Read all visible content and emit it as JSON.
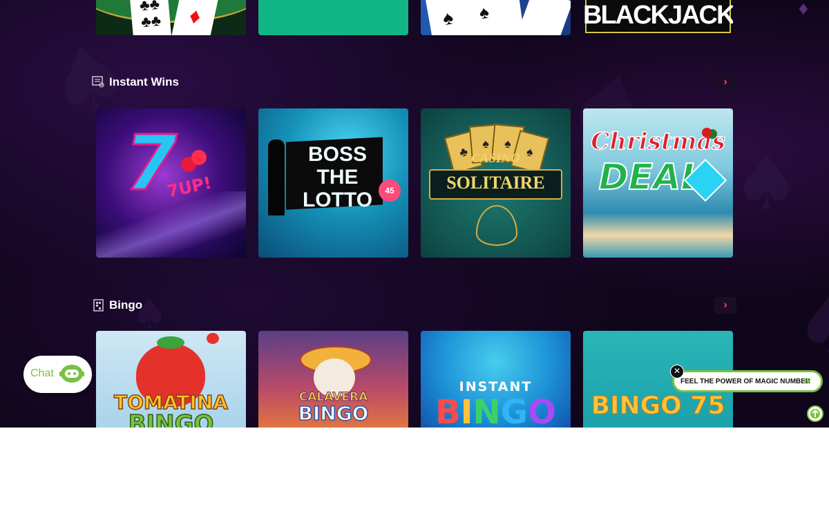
{
  "top_row": [
    {
      "name": "card-table-game"
    },
    {
      "name": "green-game"
    },
    {
      "name": "spades-card-game"
    },
    {
      "name": "blackjack-game",
      "title": "BLACKJACK"
    }
  ],
  "sections": {
    "instant_wins": {
      "title": "Instant Wins",
      "tiles": [
        {
          "title": "7UP!",
          "accent": "#ff2d86"
        },
        {
          "title": "BOSS THE LOTTO",
          "ball": "45"
        },
        {
          "title_top": "CASINO",
          "title_main": "SOLITAIRE"
        },
        {
          "title_top": "Christmas",
          "title_main": "DEAL"
        }
      ]
    },
    "bingo": {
      "title": "Bingo",
      "tiles": [
        {
          "title_top": "TOMATINA",
          "title_main": "BINGO"
        },
        {
          "title_top": "CALAVERA",
          "title_main": "BINGO"
        },
        {
          "title_top": "INSTANT",
          "title_main": "BINGO"
        },
        {
          "title_main": "BINGO 75"
        }
      ]
    }
  },
  "chat": {
    "label": "Chat"
  },
  "promo": {
    "text": "FEEL THE POWER OF MAGIC NUMBER"
  },
  "colors": {
    "accent": "#ff3c6e",
    "chat_green": "#7ac143",
    "background": "#10061c"
  }
}
